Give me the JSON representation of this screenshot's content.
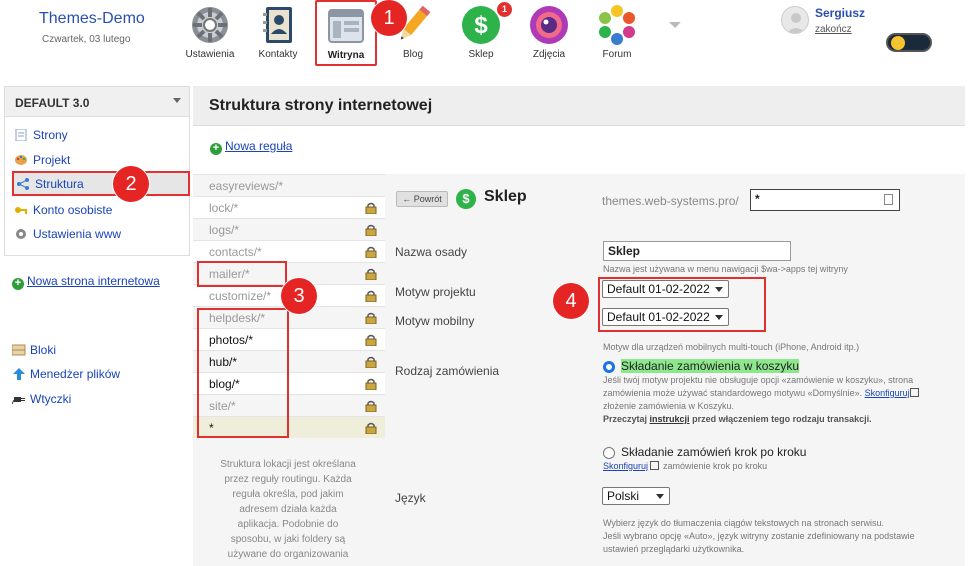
{
  "brand": {
    "title": "Themes-Demo",
    "date": "Czwartek, 03 lutego"
  },
  "nav": {
    "items": [
      {
        "label": "Ustawienia"
      },
      {
        "label": "Kontakty"
      },
      {
        "label": "Witryna"
      },
      {
        "label": "Blog"
      },
      {
        "label": "Sklep",
        "badge": "1"
      },
      {
        "label": "Zdjęcia"
      },
      {
        "label": "Forum"
      }
    ]
  },
  "callouts": [
    "1",
    "2",
    "3",
    "4"
  ],
  "user": {
    "name": "Sergiusz",
    "logout": "zakończ"
  },
  "sidebar": {
    "title": "DEFAULT 3.0",
    "items": [
      {
        "label": "Strony"
      },
      {
        "label": "Projekt"
      },
      {
        "label": "Struktura"
      },
      {
        "label": "Konto osobiste"
      },
      {
        "label": "Ustawienia www"
      }
    ],
    "new_site": "Nowa strona internetowa",
    "extras": [
      {
        "label": "Bloki"
      },
      {
        "label": "Menedżer plików"
      },
      {
        "label": "Wtyczki"
      }
    ]
  },
  "main": {
    "title": "Struktura strony internetowej",
    "new_rule": "Nowa reguła"
  },
  "rules": [
    {
      "label": "easyreviews/*"
    },
    {
      "label": "lock/*"
    },
    {
      "label": "logs/*"
    },
    {
      "label": "contacts/*"
    },
    {
      "label": "mailer/*"
    },
    {
      "label": "customize/*"
    },
    {
      "label": "helpdesk/*"
    },
    {
      "label": "photos/*"
    },
    {
      "label": "hub/*"
    },
    {
      "label": "blog/*"
    },
    {
      "label": "site/*"
    },
    {
      "label": "*"
    }
  ],
  "rules_note_lines": [
    "Struktura lokacji jest określana",
    "przez reguły routingu. Każda",
    "reguła określa, pod jakim",
    "adresem działa każda",
    "aplikacja. Podobnie do",
    "sposobu, w jaki foldery są",
    "używane do organizowania"
  ],
  "detail": {
    "back": "← Powrót",
    "title": "Sklep",
    "path_prefix": "themes.web-systems.pro/",
    "path_value": "*",
    "settlement_label": "Nazwa osady",
    "settlement_value": "Sklep",
    "settlement_hint": "Nazwa jest używana w menu nawigacji $wa->apps tej witryny",
    "project_theme_label": "Motyw projektu",
    "project_theme_value": "Default 01-02-2022",
    "mobile_theme_label": "Motyw mobilny",
    "mobile_theme_value": "Default 01-02-2022",
    "mobile_hint": "Motyw dla urządzeń mobilnych multi-touch (iPhone, Android itp.)",
    "order_label": "Rodzaj zamówienia",
    "order_option1": "Składanie zamówienia w koszyku",
    "order_hint_lines": [
      "Jeśli twój motyw projektu nie obsługuje opcji «zamówienie w koszyku», strona",
      "zamówienia może używać standardowego motywu «Domyślnie»."
    ],
    "configure": "Skonfiguruj",
    "order_hint2": "złożenie zamówienia w Koszyku.",
    "read_prefix": "Przeczytaj",
    "read_link": "instrukcji",
    "read_suffix": "przed włączeniem tego rodzaju transakcji.",
    "order_option2": "Składanie zamówień krok po kroku",
    "order_option2_hint": "zamówienie krok po kroku",
    "lang_label": "Język",
    "lang_value": "Polski",
    "lang_hint_lines": [
      "Wybierz język do tłumaczenia ciągów tekstowych na stronach serwisu.",
      "Jeśli wybrano opcję «Auto», język witryny zostanie zdefiniowany na podstawie",
      "ustawień przeglądarki użytkownika."
    ]
  }
}
